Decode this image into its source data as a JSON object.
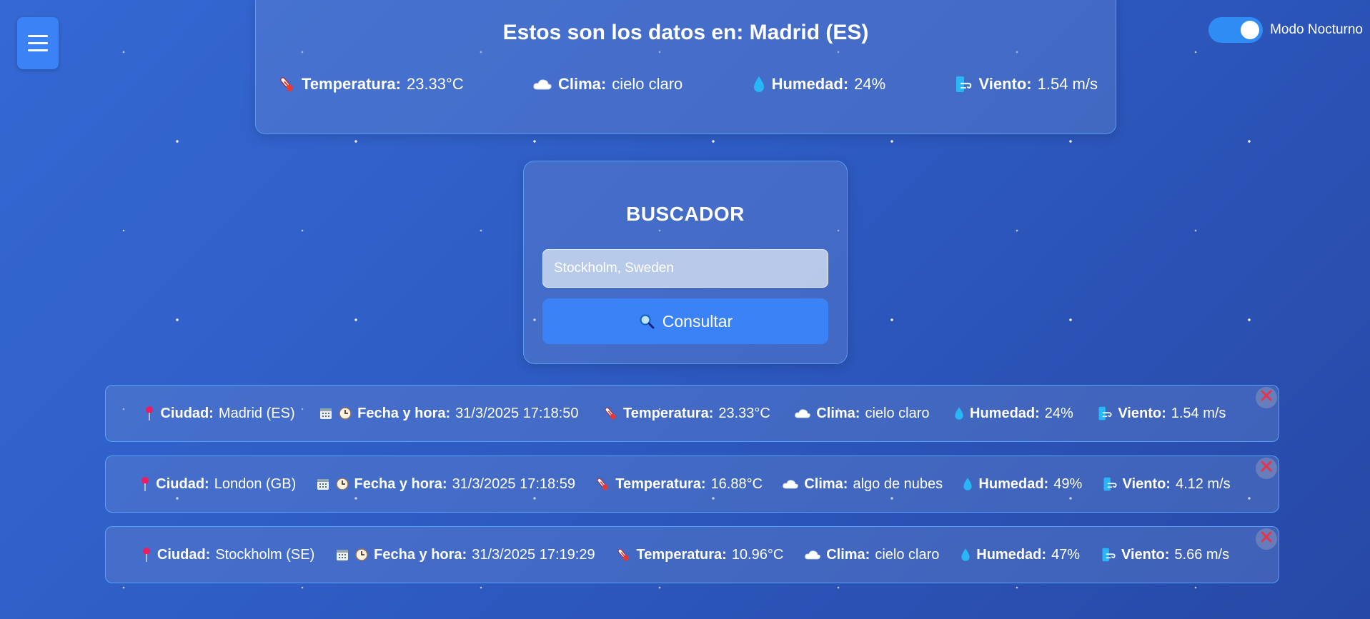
{
  "menu": {
    "icon": "hamburger-icon"
  },
  "theme_toggle": {
    "label": "Modo Nocturno",
    "on": true
  },
  "current": {
    "title": "Estos son los datos en: Madrid (ES)",
    "temp_label": "Temperatura:",
    "temp_value": "23.33°C",
    "clima_label": "Clima:",
    "clima_value": "cielo claro",
    "humedad_label": "Humedad:",
    "humedad_value": "24%",
    "viento_label": "Viento:",
    "viento_value": "1.54 m/s"
  },
  "search": {
    "title": "BUSCADOR",
    "placeholder": "Stockholm, Sweden",
    "button_label": "Consultar"
  },
  "labels": {
    "ciudad": "Ciudad:",
    "fecha": "Fecha y hora:",
    "temperatura": "Temperatura:",
    "clima": "Clima:",
    "humedad": "Humedad:",
    "viento": "Viento:"
  },
  "history": [
    {
      "ciudad": "Madrid (ES)",
      "fecha": "31/3/2025 17:18:50",
      "temperatura": "23.33°C",
      "clima": "cielo claro",
      "humedad": "24%",
      "viento": "1.54 m/s"
    },
    {
      "ciudad": "London (GB)",
      "fecha": "31/3/2025 17:18:59",
      "temperatura": "16.88°C",
      "clima": "algo de nubes",
      "humedad": "49%",
      "viento": "4.12 m/s"
    },
    {
      "ciudad": "Stockholm (SE)",
      "fecha": "31/3/2025 17:19:29",
      "temperatura": "10.96°C",
      "clima": "cielo claro",
      "humedad": "47%",
      "viento": "5.66 m/s"
    }
  ],
  "colors": {
    "accent": "#3b82f6",
    "background": "#2e5cc4",
    "close": "#e8334a"
  }
}
